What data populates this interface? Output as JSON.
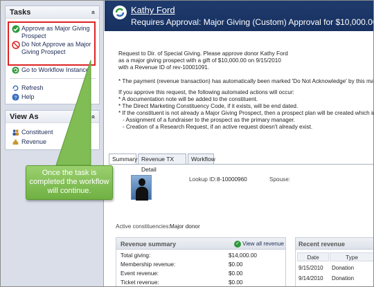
{
  "left": {
    "tasks_title": "Tasks",
    "collapse_glyph": "«",
    "approve": {
      "label": "Approve as Major Giving Prospect",
      "icon": "check-circle-icon"
    },
    "deny": {
      "label": "Do Not Approve as Major Giving Prospect",
      "icon": "no-entry-icon"
    },
    "workflow": {
      "label": "Go to Workflow Instance",
      "icon": "refresh-circle-icon"
    },
    "refresh": {
      "label": "Refresh",
      "icon": "refresh-icon"
    },
    "help": {
      "label": "Help",
      "icon": "help-icon"
    },
    "viewas_title": "View As",
    "constituent": {
      "label": "Constituent",
      "icon": "people-icon"
    },
    "revenue": {
      "label": "Revenue",
      "icon": "money-bag-icon"
    }
  },
  "callout": {
    "text": "Once the task is completed the workflow will continue."
  },
  "header": {
    "name": "Kathy Ford",
    "title": "Requires Approval: Major Giving (Custom) Approval for $10,000.00"
  },
  "body": {
    "l1": "Request to Dir. of Special Giving.  Please approve donor Kathy Ford",
    "l2": "as a major giving prospect with a gift of $10,000.00 on 9/15/2010",
    "l3": "with a Revenue ID of rev-10001091.",
    "l4": "* The payment (revenue transaction) has automatically been marked 'Do Not Acknowledge' by this major giving",
    "l5": "If you approve this request, the following automated actions will occur:",
    "l6": "* A documentation note will be added to the constituent.",
    "l7": "* The Direct Marketing Constituency Code, if it exists, will be end dated.",
    "l8": "* If the constituent is not already a Major Giving Prospect, then a prospect plan will be created which includes:",
    "l9": "   - Assignment of a fundraiser to the prospect as the primary manager.",
    "l10": "   - Creation of a Research Request, if an active request doesn't already exist."
  },
  "tabs": [
    "Summary",
    "Revenue TX Detail",
    "Workflow"
  ],
  "summary": {
    "lookup_label": "Lookup ID:",
    "lookup_value": "8-10000960",
    "spouse_label": "Spouse:",
    "constituencies_label": "Active constituencies:",
    "constituencies_value": "Major donor"
  },
  "revenue_summary": {
    "title": "Revenue summary",
    "link": "View all revenue",
    "rows": [
      {
        "name": "Total giving:",
        "value": "$14,000.00"
      },
      {
        "name": "Membership revenue:",
        "value": "$0.00"
      },
      {
        "name": "Event revenue:",
        "value": "$0.00"
      },
      {
        "name": "Ticket revenue:",
        "value": "$0.00"
      }
    ]
  },
  "recent_revenue": {
    "title": "Recent revenue",
    "columns": [
      "Date",
      "Type"
    ],
    "rows": [
      {
        "date": "9/15/2010",
        "type": "Donation"
      },
      {
        "date": "9/14/2010",
        "type": "Donation"
      }
    ]
  }
}
